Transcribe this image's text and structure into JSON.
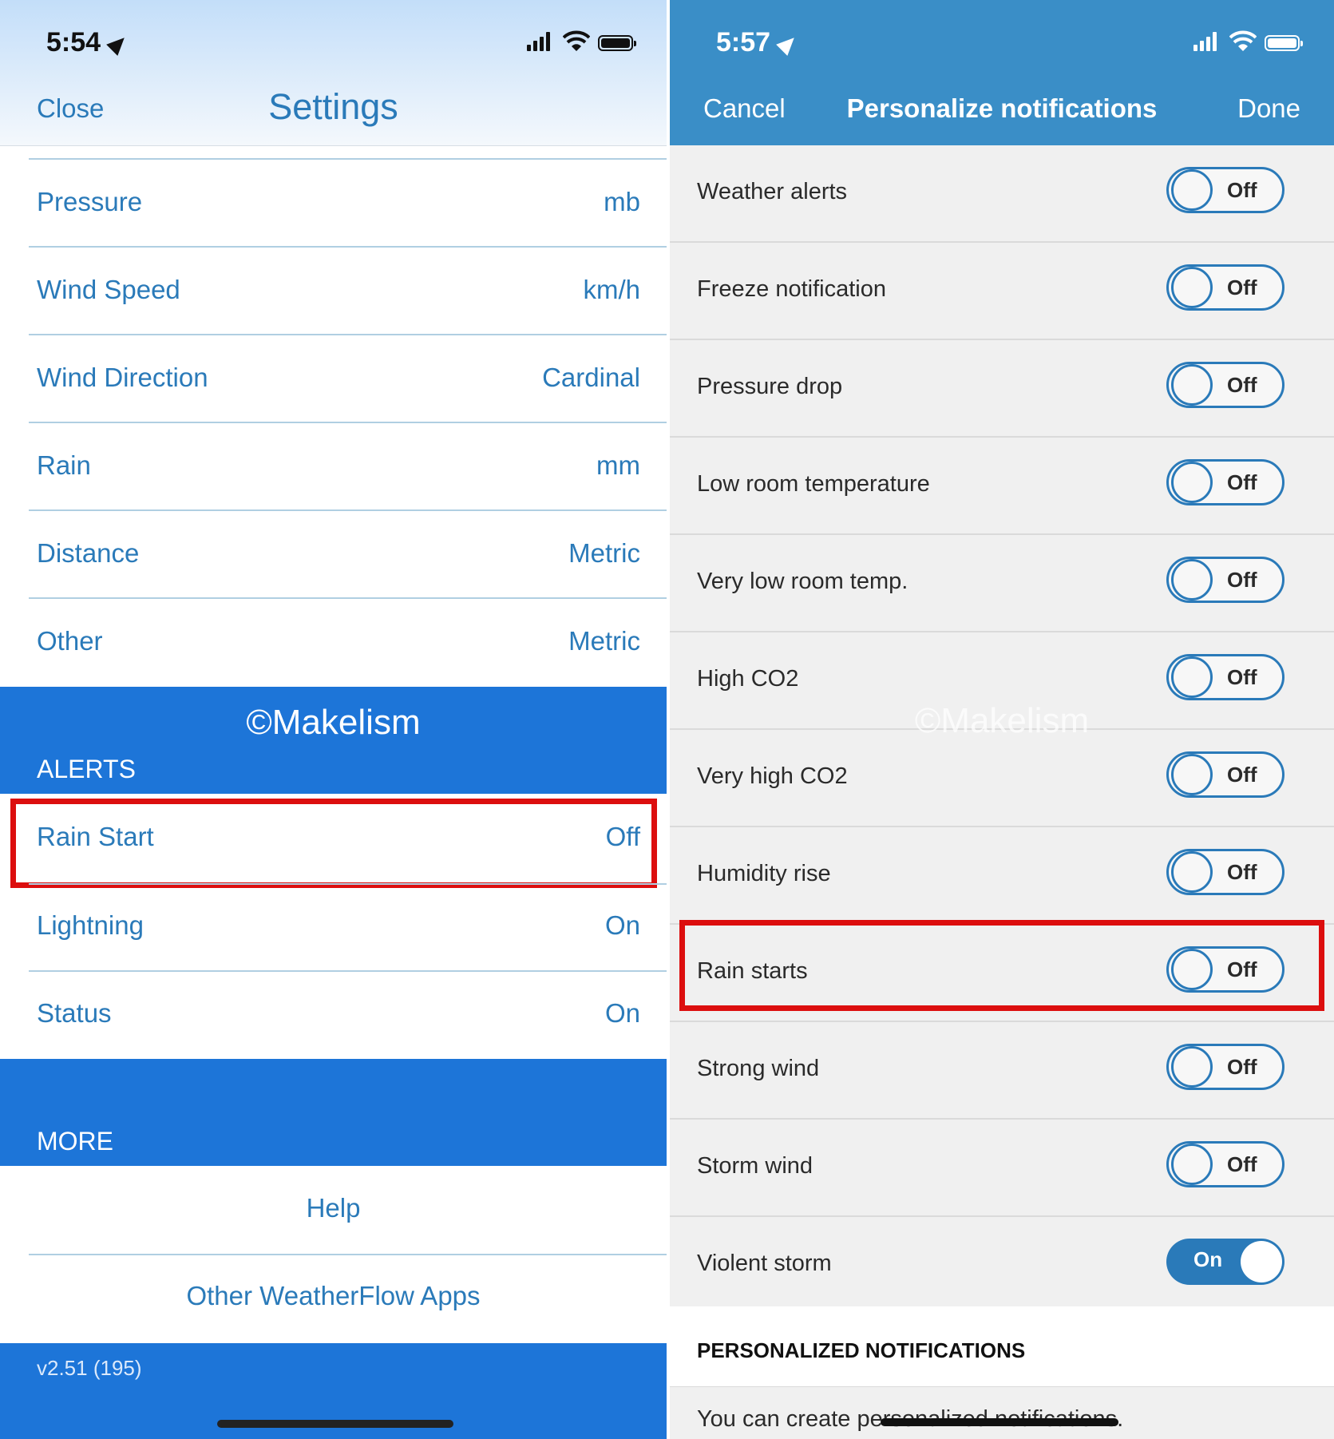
{
  "left": {
    "status": {
      "time": "5:54"
    },
    "header": {
      "close_label": "Close",
      "title": "Settings"
    },
    "unit_rows": [
      {
        "label": "Pressure",
        "value": "mb"
      },
      {
        "label": "Wind Speed",
        "value": "km/h"
      },
      {
        "label": "Wind Direction",
        "value": "Cardinal"
      },
      {
        "label": "Rain",
        "value": "mm"
      },
      {
        "label": "Distance",
        "value": "Metric"
      },
      {
        "label": "Other",
        "value": "Metric"
      }
    ],
    "watermark": "©Makelism",
    "alerts_section": "ALERTS",
    "alert_rows": [
      {
        "label": "Rain Start",
        "value": "Off"
      },
      {
        "label": "Lightning",
        "value": "On"
      },
      {
        "label": "Status",
        "value": "On"
      }
    ],
    "more_section": "MORE",
    "more_rows": [
      "Help",
      "Other WeatherFlow Apps"
    ],
    "version": "v2.51 (195)"
  },
  "right": {
    "status": {
      "time": "5:57"
    },
    "header": {
      "cancel_label": "Cancel",
      "title": "Personalize notifications",
      "done_label": "Done"
    },
    "watermark": "©Makelism",
    "notifications": [
      {
        "label": "Weather alerts",
        "state": "Off"
      },
      {
        "label": "Freeze notification",
        "state": "Off"
      },
      {
        "label": "Pressure drop",
        "state": "Off"
      },
      {
        "label": "Low room temperature",
        "state": "Off"
      },
      {
        "label": "Very low room temp.",
        "state": "Off"
      },
      {
        "label": "High CO2",
        "state": "Off"
      },
      {
        "label": "Very high CO2",
        "state": "Off"
      },
      {
        "label": "Humidity rise",
        "state": "Off"
      },
      {
        "label": "Rain starts",
        "state": "Off"
      },
      {
        "label": "Strong wind",
        "state": "Off"
      },
      {
        "label": "Storm wind",
        "state": "Off"
      },
      {
        "label": "Violent storm",
        "state": "On"
      }
    ],
    "section_title": "PERSONALIZED NOTIFICATIONS",
    "note": "You can create personalized notifications."
  },
  "colors": {
    "accent": "#2a7ab9",
    "section_blue": "#1d75d8",
    "header_blue": "#3a8ec7",
    "highlight_red": "#dc0e0e"
  }
}
